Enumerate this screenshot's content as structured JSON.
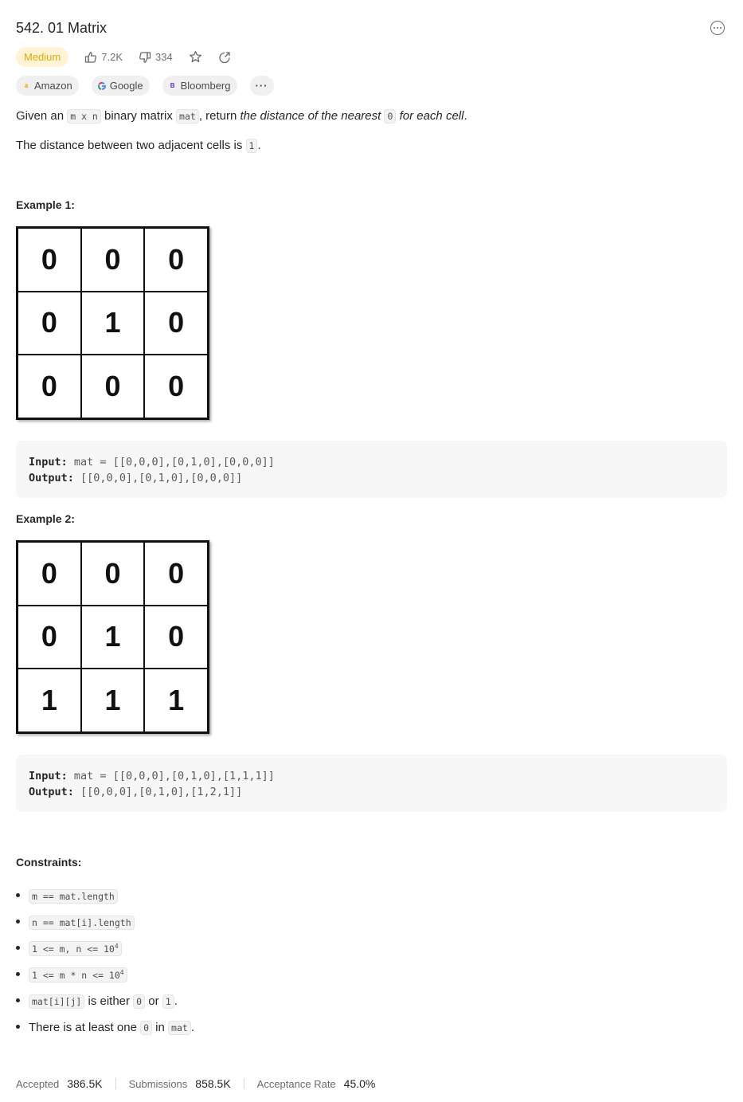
{
  "problem": {
    "title": "542. 01 Matrix",
    "difficulty": "Medium",
    "likes": "7.2K",
    "dislikes": "334"
  },
  "companies": [
    "Amazon",
    "Google",
    "Bloomberg"
  ],
  "more_tags": "···",
  "description": {
    "p1": {
      "t1": "Given an ",
      "c1": "m x n",
      "t2": " binary matrix ",
      "c2": "mat",
      "t3": ", return ",
      "e1": "the distance of the nearest ",
      "c3": "0",
      "e2": " for each cell",
      "t4": "."
    },
    "p2": {
      "t1": "The distance between two adjacent cells is ",
      "c1": "1",
      "t2": "."
    }
  },
  "examples": [
    {
      "title": "Example 1:",
      "grid": [
        [
          "0",
          "0",
          "0"
        ],
        [
          "0",
          "1",
          "0"
        ],
        [
          "0",
          "0",
          "0"
        ]
      ],
      "input_label": "Input:",
      "input": "mat = [[0,0,0],[0,1,0],[0,0,0]]",
      "output_label": "Output:",
      "output": "[[0,0,0],[0,1,0],[0,0,0]]"
    },
    {
      "title": "Example 2:",
      "grid": [
        [
          "0",
          "0",
          "0"
        ],
        [
          "0",
          "1",
          "0"
        ],
        [
          "1",
          "1",
          "1"
        ]
      ],
      "input_label": "Input:",
      "input": "mat = [[0,0,0],[0,1,0],[1,1,1]]",
      "output_label": "Output:",
      "output": "[[0,0,0],[0,1,0],[1,2,1]]"
    }
  ],
  "constraints": {
    "title": "Constraints:",
    "c1": "m == mat.length",
    "c2": "n == mat[i].length",
    "c3": "1 <= m, n <= 10",
    "c3_sup": "4",
    "c4": "1 <= m * n <= 10",
    "c4_sup": "4",
    "c5_code1": "mat[i][j]",
    "c5_t1": " is either ",
    "c5_code2": "0",
    "c5_t2": " or ",
    "c5_code3": "1",
    "c5_t3": ".",
    "c6_t1": "There is at least one ",
    "c6_code1": "0",
    "c6_t2": " in ",
    "c6_code2": "mat",
    "c6_t3": "."
  },
  "stats": {
    "accepted_label": "Accepted",
    "accepted": "386.5K",
    "submissions_label": "Submissions",
    "submissions": "858.5K",
    "rate_label": "Acceptance Rate",
    "rate": "45.0%"
  },
  "colors": {
    "difficulty_medium_text": "#e7a608",
    "difficulty_medium_bg": "#fff5d6",
    "amazon": "#ff9900",
    "bloomberg": "#5b2bd1"
  },
  "icons": [
    "more-icon",
    "thumbs-up-icon",
    "thumbs-down-icon",
    "star-icon",
    "share-icon",
    "amazon-logo",
    "google-logo",
    "bloomberg-logo"
  ]
}
